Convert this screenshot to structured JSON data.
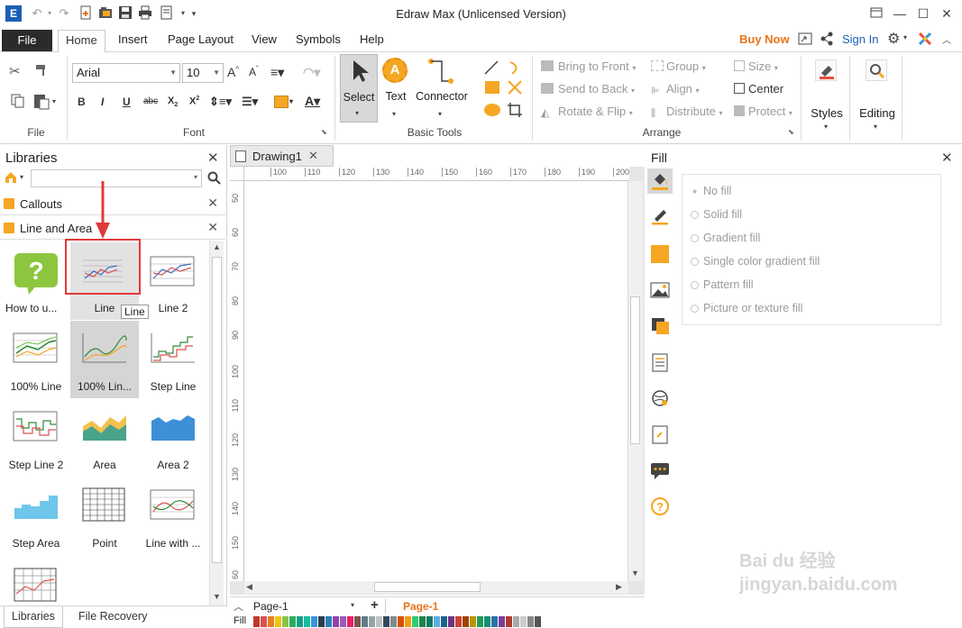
{
  "app": {
    "title": "Edraw Max (Unlicensed Version)",
    "quick_access": [
      "app-logo-icon",
      "undo-icon",
      "redo-icon",
      "new-file-icon",
      "open-icon",
      "save-icon",
      "print-icon",
      "export-icon"
    ]
  },
  "tabs": {
    "file": "File",
    "items": [
      "Home",
      "Insert",
      "Page Layout",
      "View",
      "Symbols",
      "Help"
    ],
    "buy_now": "Buy Now",
    "sign_in": "Sign In"
  },
  "ribbon": {
    "font_group_label": "Font",
    "file_group_label": "File",
    "basic_tools_label": "Basic Tools",
    "arrange_label": "Arrange",
    "font_name": "Arial",
    "font_size": "10",
    "select_label": "Select",
    "text_label": "Text",
    "connector_label": "Connector",
    "bring_to_front": "Bring to Front",
    "send_to_back": "Send to Back",
    "rotate_flip": "Rotate & Flip",
    "group": "Group",
    "align": "Align",
    "distribute": "Distribute",
    "size": "Size",
    "center": "Center",
    "protect": "Protect",
    "styles": "Styles",
    "editing": "Editing"
  },
  "libraries": {
    "title": "Libraries",
    "categories": [
      "Callouts",
      "Line and Area"
    ],
    "shapes": [
      {
        "label": "How to u..."
      },
      {
        "label": "Line"
      },
      {
        "label": "Line 2"
      },
      {
        "label": "100% Line"
      },
      {
        "label": "100% Lin..."
      },
      {
        "label": "Step Line"
      },
      {
        "label": "Step Line 2"
      },
      {
        "label": "Area"
      },
      {
        "label": "Area 2"
      },
      {
        "label": "Step Area"
      },
      {
        "label": "Point"
      },
      {
        "label": "Line with ..."
      },
      {
        "label": ""
      }
    ],
    "tooltip": "Line",
    "bottom_tabs": [
      "Libraries",
      "File Recovery"
    ]
  },
  "document": {
    "tab_name": "Drawing1",
    "h_ruler": [
      "100",
      "110",
      "120",
      "130",
      "140",
      "150",
      "160",
      "170",
      "180",
      "190",
      "200"
    ],
    "v_ruler": [
      "50",
      "60",
      "70",
      "80",
      "90",
      "100",
      "110",
      "120",
      "130",
      "140",
      "150",
      "60"
    ],
    "page_tab": "Page-1",
    "active_page": "Page-1",
    "fill_label": "Fill"
  },
  "fill_panel": {
    "title": "Fill",
    "options": [
      "No fill",
      "Solid fill",
      "Gradient fill",
      "Single color gradient fill",
      "Pattern fill",
      "Picture or texture fill"
    ]
  },
  "palette": [
    "#c0392b",
    "#d9534f",
    "#e67e22",
    "#f1c40f",
    "#8bc34a",
    "#27ae60",
    "#16a085",
    "#1abc9c",
    "#3498db",
    "#2c3e50",
    "#2980b9",
    "#8e44ad",
    "#9b59b6",
    "#e91e63",
    "#795548",
    "#607d8b",
    "#95a5a6",
    "#bdc3c7",
    "#34495e",
    "#7f8c8d",
    "#d35400",
    "#f39c12",
    "#2ecc71",
    "#1e8449",
    "#117a65",
    "#5dade2",
    "#1f618d",
    "#6c3483",
    "#cb4335",
    "#a04000",
    "#b7950b",
    "#239b56",
    "#148f77",
    "#2874a6",
    "#7d3c98",
    "#b03a2e",
    "#aaaaaa",
    "#cccccc",
    "#888888",
    "#555555"
  ],
  "watermark": "Bai du 经验 jingyan.baidu.com"
}
